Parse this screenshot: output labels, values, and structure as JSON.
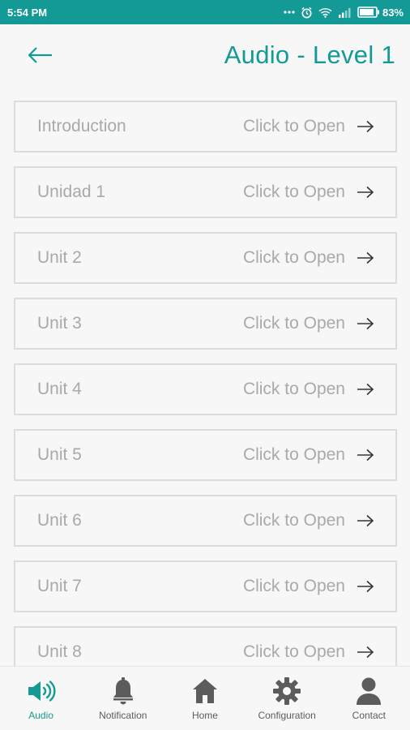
{
  "status_bar": {
    "time": "5:54 PM",
    "battery": "83%",
    "icons": [
      "more-dots-icon",
      "alarm-icon",
      "wifi-icon",
      "signal-icon",
      "battery-icon"
    ]
  },
  "header": {
    "title": "Audio - Level 1",
    "back_icon": "back-arrow-icon"
  },
  "list": {
    "items": [
      {
        "label": "Introduction",
        "action": "Click to Open"
      },
      {
        "label": "Unidad 1",
        "action": "Click to Open"
      },
      {
        "label": "Unit 2",
        "action": "Click to Open"
      },
      {
        "label": "Unit 3",
        "action": "Click to Open"
      },
      {
        "label": "Unit 4",
        "action": "Click to Open"
      },
      {
        "label": "Unit 5",
        "action": "Click to Open"
      },
      {
        "label": "Unit 6",
        "action": "Click to Open"
      },
      {
        "label": "Unit 7",
        "action": "Click to Open"
      },
      {
        "label": "Unit 8",
        "action": "Click to Open"
      }
    ]
  },
  "bottom_nav": {
    "active": "Audio",
    "items": [
      {
        "label": "Audio",
        "icon": "speaker-icon"
      },
      {
        "label": "Notification",
        "icon": "bell-icon"
      },
      {
        "label": "Home",
        "icon": "home-icon"
      },
      {
        "label": "Configuration",
        "icon": "gear-icon"
      },
      {
        "label": "Contact",
        "icon": "person-icon"
      }
    ]
  },
  "colors": {
    "accent": "#139a96",
    "item_text": "#a9a9a9",
    "item_border": "#dcdcdc",
    "nav_inactive": "#5c5c5c"
  }
}
